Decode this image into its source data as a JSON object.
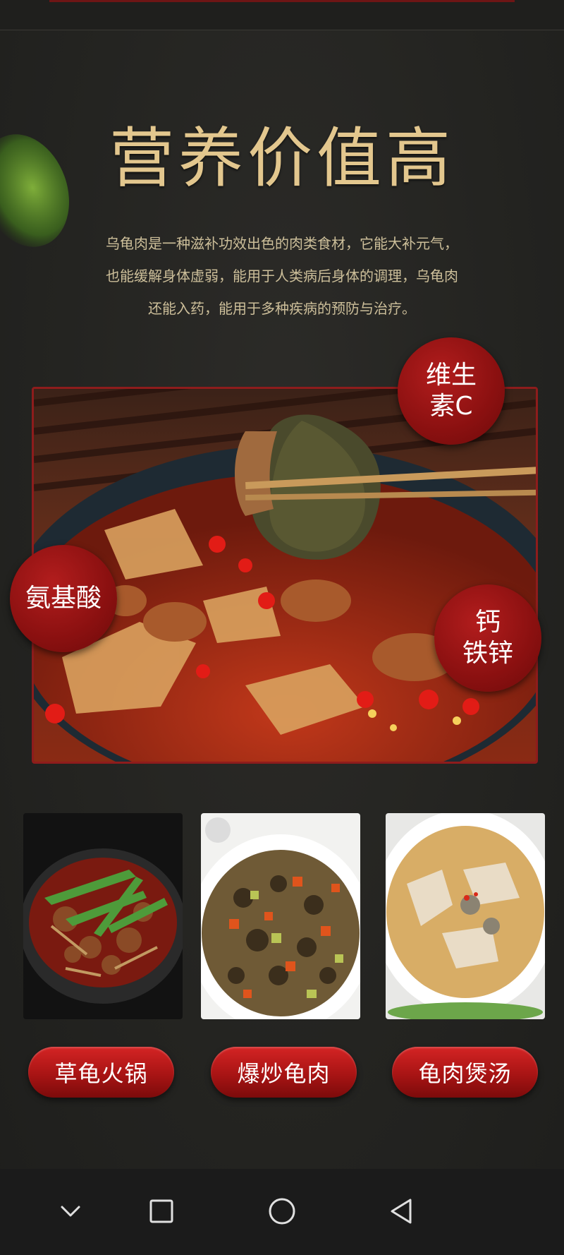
{
  "header": {
    "title": "营养价值高",
    "description_lines": [
      "乌龟肉是一种滋补功效出色的肉类食材，它能大补元气，",
      "也能缓解身体虚弱，能用于人类病后身体的调理，乌龟肉",
      "还能入药，能用于多种疾病的预防与治疗。"
    ]
  },
  "badges": {
    "vitamin_c": [
      "维生",
      "素C"
    ],
    "amino_acid": "氨基酸",
    "minerals": [
      "钙",
      "铁锌"
    ]
  },
  "dishes": [
    {
      "label": "草龟火锅"
    },
    {
      "label": "爆炒龟肉"
    },
    {
      "label": "龟肉煲汤"
    }
  ],
  "colors": {
    "title_gold": "#e3c78e",
    "badge_red": "#8a1010",
    "pill_red": "#a81414",
    "background": "#242421"
  },
  "navbar": {
    "icons": [
      "chevron-down-icon",
      "square-icon",
      "circle-icon",
      "triangle-back-icon"
    ]
  }
}
